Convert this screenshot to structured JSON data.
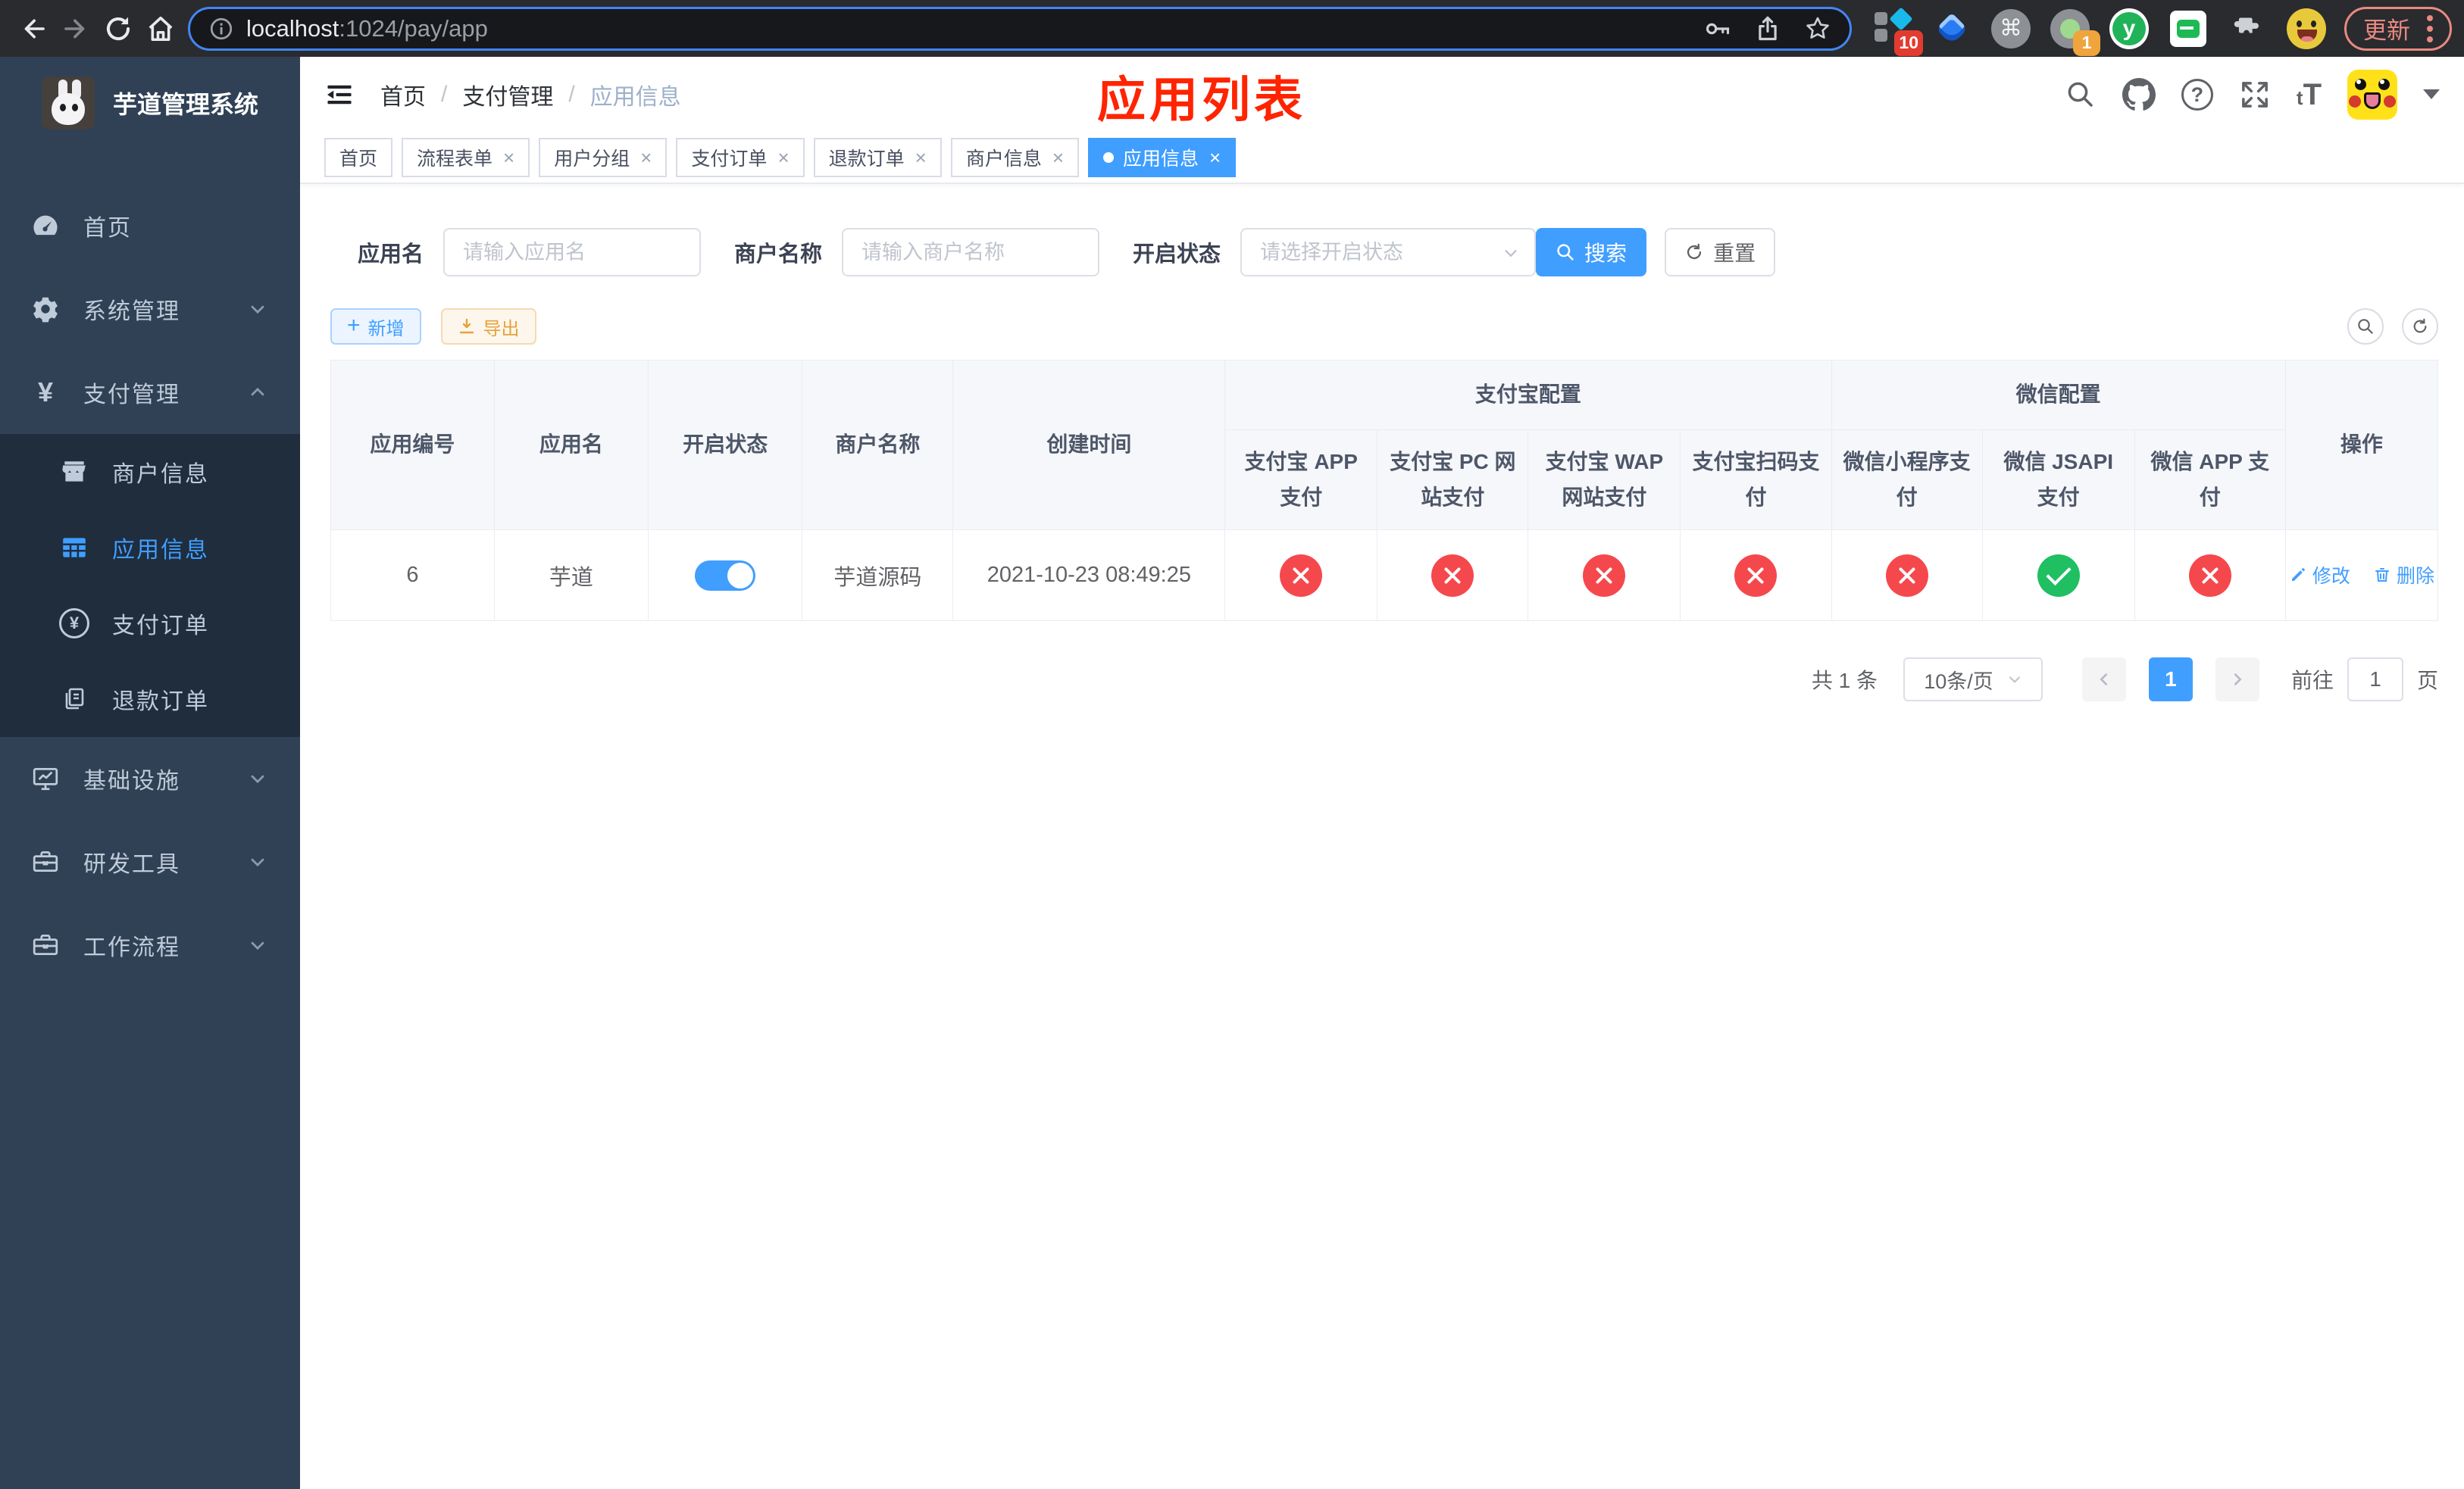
{
  "colors": {
    "primary": "#409eff",
    "success": "#1fbf62",
    "danger": "#f5484d",
    "warning": "#e6a23c",
    "annotation_red": "#ff2400",
    "sidebar_bg": "#304156",
    "submenu_bg": "#1f2d3d"
  },
  "icons": {
    "close": "×",
    "plus": "+",
    "question": "?",
    "command": "⌘",
    "y_logo": "y",
    "font_small": "t",
    "font_big": "T",
    "yen": "¥"
  },
  "browser": {
    "url_host": "localhost",
    "url_rest": ":1024/pay/app",
    "update_label": "更新",
    "ext_badge_a": "10",
    "ext_badge_b": "1"
  },
  "sidebar": {
    "title": "芋道管理系统",
    "items": [
      {
        "label": "首页"
      },
      {
        "label": "系统管理"
      },
      {
        "label": "支付管理"
      },
      {
        "label": "商户信息"
      },
      {
        "label": "应用信息"
      },
      {
        "label": "支付订单"
      },
      {
        "label": "退款订单"
      },
      {
        "label": "基础设施"
      },
      {
        "label": "研发工具"
      },
      {
        "label": "工作流程"
      }
    ]
  },
  "header": {
    "breadcrumb": [
      "首页",
      "支付管理",
      "应用信息"
    ],
    "separator": "/",
    "annotation": "应用列表"
  },
  "tabs": [
    {
      "label": "首页"
    },
    {
      "label": "流程表单"
    },
    {
      "label": "用户分组"
    },
    {
      "label": "支付订单"
    },
    {
      "label": "退款订单"
    },
    {
      "label": "商户信息"
    },
    {
      "label": "应用信息"
    }
  ],
  "filters": {
    "app_name_label": "应用名",
    "app_name_placeholder": "请输入应用名",
    "merchant_label": "商户名称",
    "merchant_placeholder": "请输入商户名称",
    "status_label": "开启状态",
    "status_placeholder": "请选择开启状态",
    "search_label": "搜索",
    "reset_label": "重置"
  },
  "toolbar": {
    "add_label": "新增",
    "export_label": "导出"
  },
  "table": {
    "group_headers": {
      "alipay": "支付宝配置",
      "wechat": "微信配置"
    },
    "headers": {
      "id": "应用编号",
      "name": "应用名",
      "enabled": "开启状态",
      "merchant": "商户名称",
      "created": "创建时间",
      "alipay_app": "支付宝 APP 支付",
      "alipay_pc": "支付宝 PC 网站支付",
      "alipay_wap": "支付宝 WAP 网站支付",
      "alipay_qr": "支付宝扫码支付",
      "wx_lite": "微信小程序支付",
      "wx_jsapi": "微信 JSAPI 支付",
      "wx_app": "微信 APP 支付",
      "ops": "操作"
    },
    "row": {
      "id": "6",
      "name": "芋道",
      "enabled": true,
      "merchant": "芋道源码",
      "created": "2021-10-23 08:49:25",
      "channels": [
        false,
        false,
        false,
        false,
        false,
        true,
        false
      ],
      "edit_label": "修改",
      "delete_label": "删除"
    }
  },
  "pagination": {
    "total": "共 1 条",
    "page_size": "10条/页",
    "page": "1",
    "goto_prefix": "前往",
    "goto_value": "1",
    "goto_suffix": "页"
  }
}
